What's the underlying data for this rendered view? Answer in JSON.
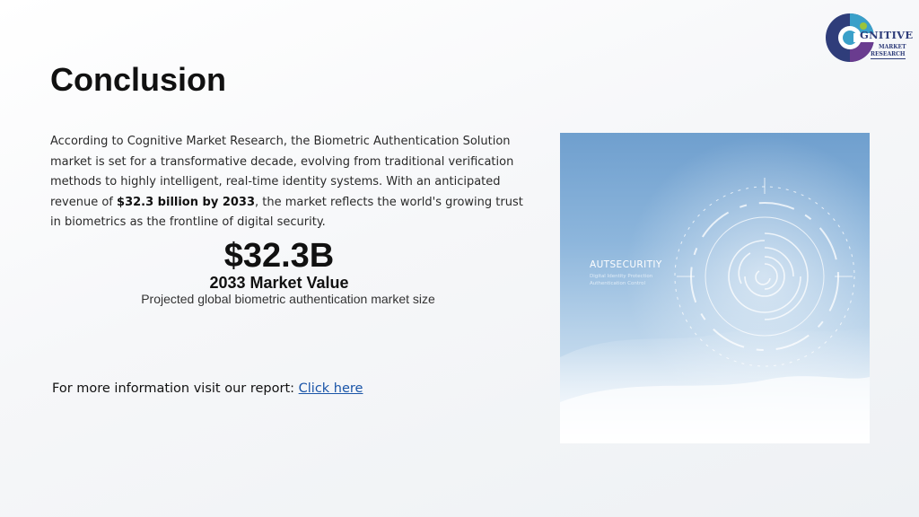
{
  "logo": {
    "wordmark": "GNITIVE",
    "line1": "MARKET",
    "line2": "RESEARCH",
    "colors": [
      "#3aa0c9",
      "#2f3d7a",
      "#9bc43a"
    ]
  },
  "title": "Conclusion",
  "paragraph": {
    "before": "According to Cognitive Market Research, the Biometric Authentication Solution market is set for a transformative decade, evolving from traditional verification methods to highly intelligent, real-time identity systems. With an anticipated revenue of ",
    "highlight": "$32.3 billion by 2033",
    "after": ", the market reflects the world's growing trust in biometrics as the frontline of digital security."
  },
  "stat": {
    "value": "$32.3B",
    "label": "2033 Market Value",
    "description": "Projected global biometric authentication market size"
  },
  "more_info": {
    "text": "For more information visit our report: ",
    "link_label": "Click here"
  },
  "hero_image": {
    "brand": "AUTSECURITIY",
    "caption_line1": "Digital Identity Protection",
    "caption_line2": "Authentication Control",
    "icon": "fingerprint-icon",
    "accent": "#6f9fce"
  }
}
